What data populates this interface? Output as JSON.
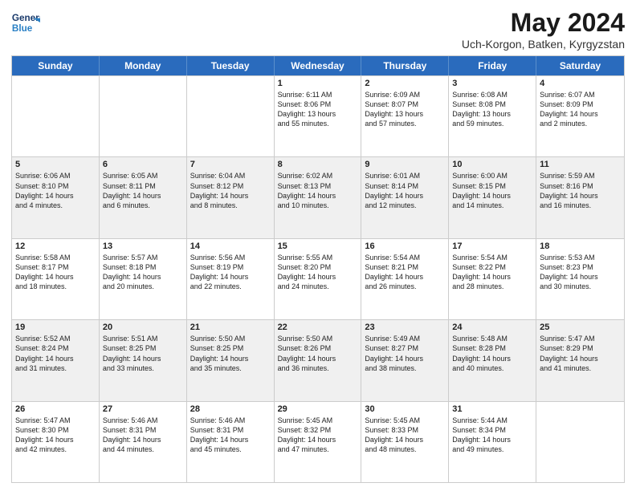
{
  "header": {
    "logo": {
      "general": "General",
      "blue": "Blue"
    },
    "title": "May 2024",
    "subtitle": "Uch-Korgon, Batken, Kyrgyzstan"
  },
  "days_of_week": [
    "Sunday",
    "Monday",
    "Tuesday",
    "Wednesday",
    "Thursday",
    "Friday",
    "Saturday"
  ],
  "weeks": [
    [
      {
        "day": "",
        "text": ""
      },
      {
        "day": "",
        "text": ""
      },
      {
        "day": "",
        "text": ""
      },
      {
        "day": "1",
        "text": "Sunrise: 6:11 AM\nSunset: 8:06 PM\nDaylight: 13 hours\nand 55 minutes."
      },
      {
        "day": "2",
        "text": "Sunrise: 6:09 AM\nSunset: 8:07 PM\nDaylight: 13 hours\nand 57 minutes."
      },
      {
        "day": "3",
        "text": "Sunrise: 6:08 AM\nSunset: 8:08 PM\nDaylight: 13 hours\nand 59 minutes."
      },
      {
        "day": "4",
        "text": "Sunrise: 6:07 AM\nSunset: 8:09 PM\nDaylight: 14 hours\nand 2 minutes."
      }
    ],
    [
      {
        "day": "5",
        "text": "Sunrise: 6:06 AM\nSunset: 8:10 PM\nDaylight: 14 hours\nand 4 minutes."
      },
      {
        "day": "6",
        "text": "Sunrise: 6:05 AM\nSunset: 8:11 PM\nDaylight: 14 hours\nand 6 minutes."
      },
      {
        "day": "7",
        "text": "Sunrise: 6:04 AM\nSunset: 8:12 PM\nDaylight: 14 hours\nand 8 minutes."
      },
      {
        "day": "8",
        "text": "Sunrise: 6:02 AM\nSunset: 8:13 PM\nDaylight: 14 hours\nand 10 minutes."
      },
      {
        "day": "9",
        "text": "Sunrise: 6:01 AM\nSunset: 8:14 PM\nDaylight: 14 hours\nand 12 minutes."
      },
      {
        "day": "10",
        "text": "Sunrise: 6:00 AM\nSunset: 8:15 PM\nDaylight: 14 hours\nand 14 minutes."
      },
      {
        "day": "11",
        "text": "Sunrise: 5:59 AM\nSunset: 8:16 PM\nDaylight: 14 hours\nand 16 minutes."
      }
    ],
    [
      {
        "day": "12",
        "text": "Sunrise: 5:58 AM\nSunset: 8:17 PM\nDaylight: 14 hours\nand 18 minutes."
      },
      {
        "day": "13",
        "text": "Sunrise: 5:57 AM\nSunset: 8:18 PM\nDaylight: 14 hours\nand 20 minutes."
      },
      {
        "day": "14",
        "text": "Sunrise: 5:56 AM\nSunset: 8:19 PM\nDaylight: 14 hours\nand 22 minutes."
      },
      {
        "day": "15",
        "text": "Sunrise: 5:55 AM\nSunset: 8:20 PM\nDaylight: 14 hours\nand 24 minutes."
      },
      {
        "day": "16",
        "text": "Sunrise: 5:54 AM\nSunset: 8:21 PM\nDaylight: 14 hours\nand 26 minutes."
      },
      {
        "day": "17",
        "text": "Sunrise: 5:54 AM\nSunset: 8:22 PM\nDaylight: 14 hours\nand 28 minutes."
      },
      {
        "day": "18",
        "text": "Sunrise: 5:53 AM\nSunset: 8:23 PM\nDaylight: 14 hours\nand 30 minutes."
      }
    ],
    [
      {
        "day": "19",
        "text": "Sunrise: 5:52 AM\nSunset: 8:24 PM\nDaylight: 14 hours\nand 31 minutes."
      },
      {
        "day": "20",
        "text": "Sunrise: 5:51 AM\nSunset: 8:25 PM\nDaylight: 14 hours\nand 33 minutes."
      },
      {
        "day": "21",
        "text": "Sunrise: 5:50 AM\nSunset: 8:25 PM\nDaylight: 14 hours\nand 35 minutes."
      },
      {
        "day": "22",
        "text": "Sunrise: 5:50 AM\nSunset: 8:26 PM\nDaylight: 14 hours\nand 36 minutes."
      },
      {
        "day": "23",
        "text": "Sunrise: 5:49 AM\nSunset: 8:27 PM\nDaylight: 14 hours\nand 38 minutes."
      },
      {
        "day": "24",
        "text": "Sunrise: 5:48 AM\nSunset: 8:28 PM\nDaylight: 14 hours\nand 40 minutes."
      },
      {
        "day": "25",
        "text": "Sunrise: 5:47 AM\nSunset: 8:29 PM\nDaylight: 14 hours\nand 41 minutes."
      }
    ],
    [
      {
        "day": "26",
        "text": "Sunrise: 5:47 AM\nSunset: 8:30 PM\nDaylight: 14 hours\nand 42 minutes."
      },
      {
        "day": "27",
        "text": "Sunrise: 5:46 AM\nSunset: 8:31 PM\nDaylight: 14 hours\nand 44 minutes."
      },
      {
        "day": "28",
        "text": "Sunrise: 5:46 AM\nSunset: 8:31 PM\nDaylight: 14 hours\nand 45 minutes."
      },
      {
        "day": "29",
        "text": "Sunrise: 5:45 AM\nSunset: 8:32 PM\nDaylight: 14 hours\nand 47 minutes."
      },
      {
        "day": "30",
        "text": "Sunrise: 5:45 AM\nSunset: 8:33 PM\nDaylight: 14 hours\nand 48 minutes."
      },
      {
        "day": "31",
        "text": "Sunrise: 5:44 AM\nSunset: 8:34 PM\nDaylight: 14 hours\nand 49 minutes."
      },
      {
        "day": "",
        "text": ""
      }
    ]
  ],
  "accent_color": "#2a6bbd"
}
